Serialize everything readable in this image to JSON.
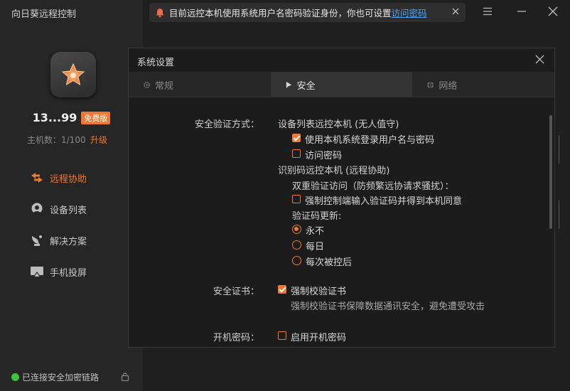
{
  "app": {
    "title": "向日葵远程控制"
  },
  "profile": {
    "device_id": "13...99",
    "plan_badge": "免费版",
    "host_count": "主机数：1/100",
    "upgrade": "升级"
  },
  "nav": [
    {
      "label": "远程协助",
      "icon": "remote-assist-icon",
      "active": true
    },
    {
      "label": "设备列表",
      "icon": "device-list-icon",
      "active": false
    },
    {
      "label": "解决方案",
      "icon": "solution-icon",
      "active": false
    },
    {
      "label": "手机投屏",
      "icon": "screen-cast-icon",
      "active": false
    }
  ],
  "status": {
    "text": "已连接安全加密链路"
  },
  "notice": {
    "text": "目前远控本机使用系统用户名密码验证身份，你也可设置",
    "link": "访问密码"
  },
  "dialog": {
    "title": "系统设置",
    "tabs": [
      {
        "label": "常规",
        "active": false
      },
      {
        "label": "安全",
        "active": true
      },
      {
        "label": "网络",
        "active": false
      }
    ],
    "auth": {
      "label": "安全验证方式：",
      "device_list_title": "设备列表远控本机 (无人值守)",
      "use_system_login": "使用本机系统登录用户名与密码",
      "access_password": "访问密码",
      "id_code_title": "识别码远控本机 (远程协助)",
      "dual_verify": "双重验证访问（防频繁远协请求骚扰）：",
      "force_verify": "强制控制端输入验证码并得到本机同意",
      "code_update": "验证码更新:",
      "never": "永不",
      "daily": "每日",
      "each_time": "每次被控后"
    },
    "cert": {
      "label": "安全证书：",
      "force_cert": "强制校验证书",
      "desc": "强制校验证书保障数据通讯安全，避免遭受攻击"
    },
    "boot": {
      "label": "开机密码：",
      "enable": "启用开机密码"
    }
  },
  "colors": {
    "accent": "#f07830",
    "link": "#4aa3ff",
    "status_ok": "#3cc43c"
  }
}
